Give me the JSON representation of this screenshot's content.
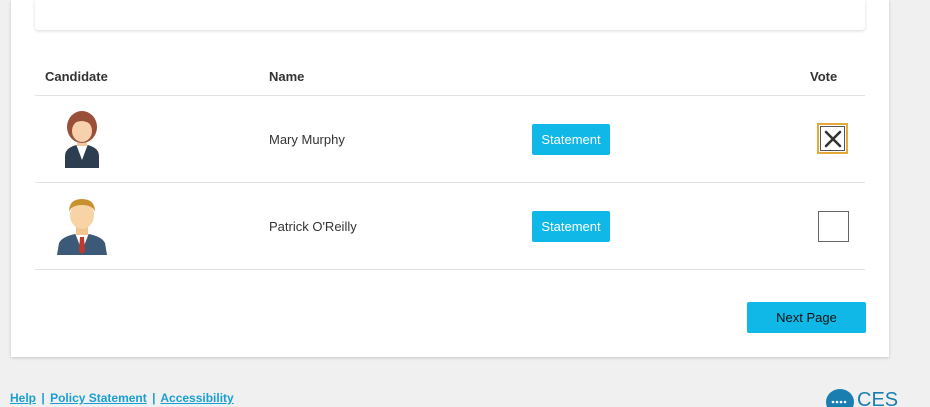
{
  "table": {
    "headers": {
      "candidate": "Candidate",
      "name": "Name",
      "vote": "Vote"
    },
    "rows": [
      {
        "name": "Mary Murphy",
        "statement_label": "Statement",
        "vote": "selected",
        "avatar": "female-avatar-icon"
      },
      {
        "name": "Patrick O'Reilly",
        "statement_label": "Statement",
        "vote": "empty",
        "avatar": "male-avatar-icon"
      }
    ]
  },
  "next_button": {
    "label": "Next Page"
  },
  "footer": {
    "help": "Help",
    "sep": "|",
    "policy": "Policy Statement",
    "accessibility": "Accessibility"
  },
  "logo": {
    "text": "CES"
  },
  "colors": {
    "accent": "#0fb8e6",
    "link": "#1a9fd4",
    "selected_border": "#e3a93a"
  }
}
